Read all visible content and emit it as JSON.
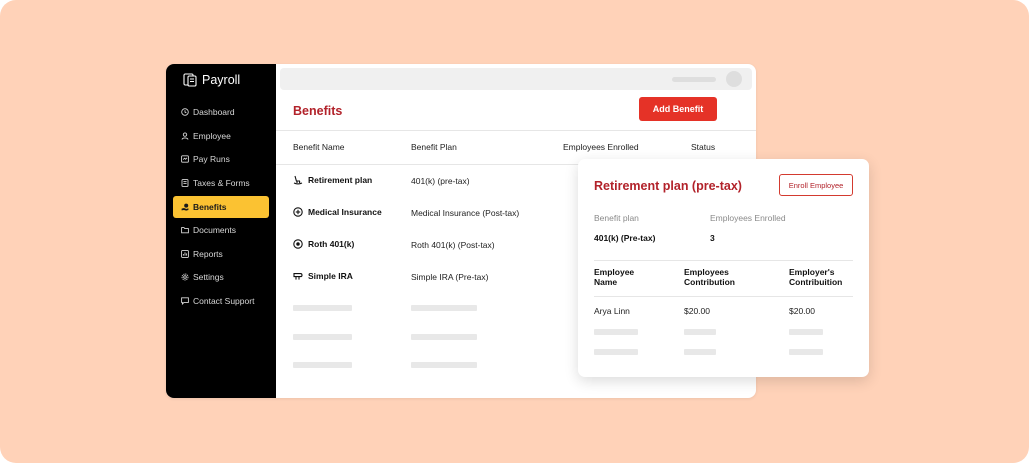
{
  "app": {
    "title": "Payroll"
  },
  "sidebar": {
    "items": [
      {
        "label": "Dashboard",
        "icon": "clock-icon"
      },
      {
        "label": "Employee",
        "icon": "user-icon"
      },
      {
        "label": "Pay Runs",
        "icon": "payrun-icon"
      },
      {
        "label": "Taxes & Forms",
        "icon": "document-icon"
      },
      {
        "label": "Benefits",
        "icon": "benefits-icon",
        "active": true
      },
      {
        "label": "Documents",
        "icon": "folder-icon"
      },
      {
        "label": "Reports",
        "icon": "chart-icon"
      },
      {
        "label": "Settings",
        "icon": "gear-icon"
      },
      {
        "label": "Contact Support",
        "icon": "chat-icon"
      }
    ]
  },
  "main": {
    "title": "Benefits",
    "add_button": "Add Benefit",
    "columns": [
      "Benefit Name",
      "Benefit Plan",
      "Employees Enrolled",
      "Status"
    ],
    "rows": [
      {
        "name": "Retirement plan",
        "plan": "401(k) (pre-tax)",
        "icon": "rocking-chair-icon"
      },
      {
        "name": "Medical Insurance",
        "plan": "Medical Insurance (Post-tax)",
        "icon": "medical-plus-icon"
      },
      {
        "name": "Roth 401(k)",
        "plan": "Roth 401(k) (Post-tax)",
        "icon": "target-icon"
      },
      {
        "name": "Simple IRA",
        "plan": "Simple IRA (Pre-tax)",
        "icon": "piggy-icon"
      }
    ]
  },
  "detail": {
    "title": "Retirement plan (pre-tax)",
    "enroll_button": "Enroll Employee",
    "plan_label": "Benefit plan",
    "plan_value": "401(k) (Pre-tax)",
    "enrolled_label": "Employees Enrolled",
    "enrolled_value": "3",
    "columns": [
      {
        "line1": "Employee",
        "line2": "Name"
      },
      {
        "line1": "Employees",
        "line2": "Contribution"
      },
      {
        "line1": "Employer's",
        "line2": "Contribuition"
      }
    ],
    "rows": [
      {
        "name": "Arya Linn",
        "employee": "$20.00",
        "employer": "$20.00"
      }
    ]
  },
  "colors": {
    "background": "#ffd2b8",
    "sidebar": "#000000",
    "active": "#fbc232",
    "accent_red": "#e53227",
    "title_red": "#b2222a"
  }
}
